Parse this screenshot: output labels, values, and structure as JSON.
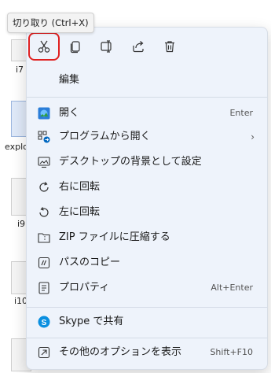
{
  "tooltip": "切り取り (Ctrl+X)",
  "desktop": {
    "labels": [
      "i7",
      "explo",
      "i9",
      "i10"
    ]
  },
  "toolbar": {
    "cut": "scissors-icon",
    "copy": "copy-icon",
    "rename": "rename-icon",
    "share": "share-icon",
    "delete": "trash-icon"
  },
  "menu": {
    "edit": "編集",
    "open": {
      "label": "開く",
      "shortcut": "Enter"
    },
    "open_with": {
      "label": "プログラムから開く",
      "arrow": "›"
    },
    "set_bg": "デスクトップの背景として設定",
    "rotate_right": "右に回転",
    "rotate_left": "左に回転",
    "zip": "ZIP ファイルに圧縮する",
    "copy_path": "パスのコピー",
    "properties": {
      "label": "プロパティ",
      "shortcut": "Alt+Enter"
    },
    "skype": "Skype で共有",
    "more_options": {
      "label": "その他のオプションを表示",
      "shortcut": "Shift+F10"
    }
  },
  "colors": {
    "accent": "#0067c0",
    "highlight_box": "#e02020",
    "menu_bg": "#eef3fb"
  }
}
